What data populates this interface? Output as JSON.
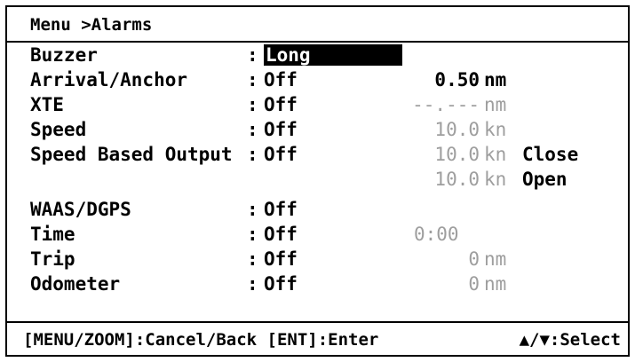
{
  "header": {
    "breadcrumb": "Menu >Alarms"
  },
  "rows": [
    {
      "label": "Buzzer",
      "colon": ":",
      "value": "Long"
    },
    {
      "label": "Arrival/Anchor",
      "colon": ":",
      "value": "Off",
      "amount": "0.50",
      "unit": "nm"
    },
    {
      "label": "XTE",
      "colon": ":",
      "value": "Off",
      "amount": "--.---",
      "unit": "nm"
    },
    {
      "label": "Speed",
      "colon": ":",
      "value": "Off",
      "amount": "10.0",
      "unit": "kn"
    },
    {
      "label": "Speed Based Output",
      "colon": ":",
      "value": "Off",
      "amount": "10.0",
      "unit": "kn",
      "extra": "Close"
    },
    {
      "amount": "10.0",
      "unit": "kn",
      "extra": "Open"
    },
    {
      "label": "WAAS/DGPS",
      "colon": ":",
      "value": "Off"
    },
    {
      "label": "Time",
      "colon": ":",
      "value": "Off",
      "amount": "0:00"
    },
    {
      "label": "Trip",
      "colon": ":",
      "value": "Off",
      "amount": "0",
      "unit": "nm"
    },
    {
      "label": "Odometer",
      "colon": ":",
      "value": "Off",
      "amount": "0",
      "unit": "nm"
    }
  ],
  "footer": {
    "left": "[MENU/ZOOM]:Cancel/Back [ENT]:Enter",
    "right": "▲/▼:Select"
  }
}
